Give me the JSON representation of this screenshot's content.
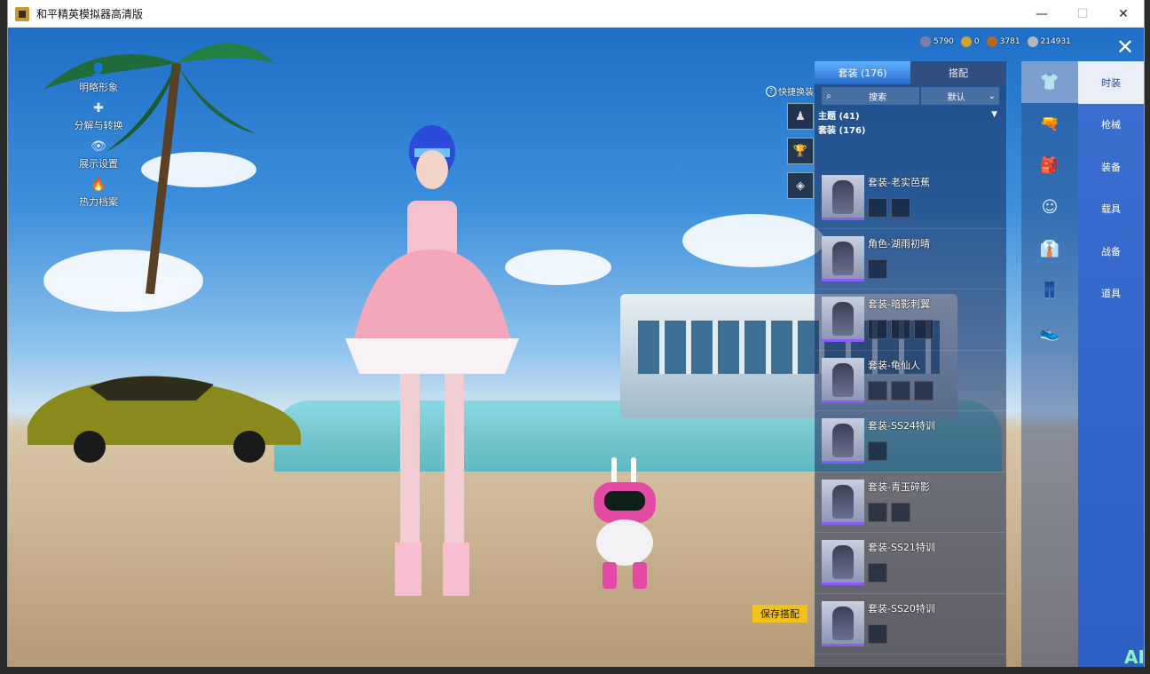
{
  "window": {
    "title": "和平精英模拟器高清版",
    "minimize": "—",
    "maximize": "☐",
    "close": "✕"
  },
  "left_menu": [
    {
      "icon": "person-icon",
      "glyph": "👤",
      "label": "明略形象"
    },
    {
      "icon": "puzzle-icon",
      "glyph": "✚",
      "label": "分解与转换"
    },
    {
      "icon": "eye-icon",
      "glyph": "👁",
      "label": "展示设置"
    },
    {
      "icon": "flame-icon",
      "glyph": "🔥",
      "label": "热力档案"
    }
  ],
  "quick_outfit": {
    "label": "快捷换装",
    "help_glyph": "?",
    "slots": [
      {
        "icon": "outfit-slot-icon",
        "glyph": "♟"
      },
      {
        "icon": "trophy-icon",
        "glyph": "🏆"
      },
      {
        "icon": "emblem-icon",
        "glyph": "◈"
      }
    ]
  },
  "save_button": "保存搭配",
  "currency": [
    {
      "icon": "token-icon",
      "value": "5790",
      "color": "#7a7fa8"
    },
    {
      "icon": "coin-gold-icon",
      "value": "0",
      "color": "#d7a12a"
    },
    {
      "icon": "coin-bronze-icon",
      "value": "3781",
      "color": "#b36a1d"
    },
    {
      "icon": "diamond-icon",
      "value": "214931",
      "color": "#b6b6b6"
    }
  ],
  "close_glyph": "✕",
  "panel": {
    "tabs": [
      {
        "label": "套装 (176)",
        "active": true
      },
      {
        "label": "搭配",
        "active": false
      }
    ],
    "search_placeholder": "搜索",
    "search_glyph": "⌕",
    "sort": {
      "value": "默认",
      "glyph": "⌄"
    },
    "filters": [
      "主题 (41)",
      "套装 (176)"
    ],
    "filter_arrow": "▼",
    "items": [
      {
        "name": "套装-老实芭蕉",
        "subs": 2
      },
      {
        "name": "角色-湖雨初晴",
        "subs": 1
      },
      {
        "name": "套装-暗影刺翼",
        "subs": 3
      },
      {
        "name": "套装-龟仙人",
        "subs": 3
      },
      {
        "name": "套装-SS24特训",
        "subs": 1
      },
      {
        "name": "套装-青玉碎影",
        "subs": 2
      },
      {
        "name": "套装-SS21特训",
        "subs": 1
      },
      {
        "name": "套装-SS20特训",
        "subs": 1
      }
    ]
  },
  "category_icons": [
    {
      "icon": "outfit-category-icon",
      "glyph": "👕",
      "active": true
    },
    {
      "icon": "gun-skin-icon",
      "glyph": "🔫",
      "active": false
    },
    {
      "icon": "backpack-icon",
      "glyph": "🎒",
      "active": false
    },
    {
      "icon": "face-icon",
      "glyph": "☺",
      "active": false
    },
    {
      "icon": "top-icon",
      "glyph": "👔",
      "active": false
    },
    {
      "icon": "pants-icon",
      "glyph": "👖",
      "active": false
    },
    {
      "icon": "shoes-icon",
      "glyph": "👟",
      "active": false
    }
  ],
  "nav": [
    {
      "label": "时装",
      "active": true
    },
    {
      "label": "枪械",
      "active": false
    },
    {
      "label": "装备",
      "active": false
    },
    {
      "label": "载具",
      "active": false
    },
    {
      "label": "战备",
      "active": false
    },
    {
      "label": "道具",
      "active": false
    }
  ],
  "watermark": "AI"
}
